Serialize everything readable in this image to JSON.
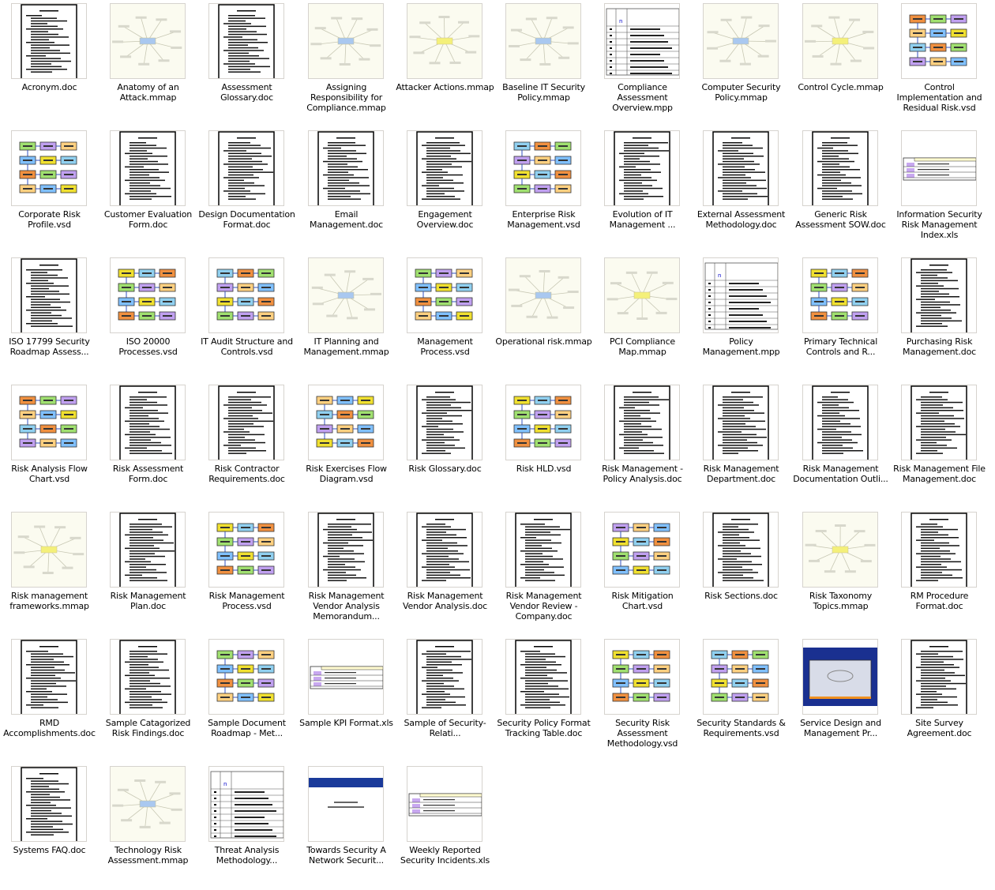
{
  "view": "thumbnails",
  "files": [
    {
      "name": "Acronym.doc",
      "type": "doc"
    },
    {
      "name": "Anatomy of an Attack.mmap",
      "type": "mmap"
    },
    {
      "name": "Assessment Glossary.doc",
      "type": "doc"
    },
    {
      "name": "Assigning Responsibility for Compliance.mmap",
      "type": "mmap"
    },
    {
      "name": "Attacker Actions.mmap",
      "type": "mmap"
    },
    {
      "name": "Baseline IT Security Policy.mmap",
      "type": "mmap"
    },
    {
      "name": "Compliance Assessment Overview.mpp",
      "type": "mpp"
    },
    {
      "name": "Computer Security Policy.mmap",
      "type": "mmap"
    },
    {
      "name": "Control Cycle.mmap",
      "type": "mmap"
    },
    {
      "name": "Control Implementation and Residual Risk.vsd",
      "type": "vsd"
    },
    {
      "name": "Corporate Risk Profile.vsd",
      "type": "vsd"
    },
    {
      "name": "Customer Evaluation Form.doc",
      "type": "doc"
    },
    {
      "name": "Design Documentation Format.doc",
      "type": "doc"
    },
    {
      "name": "Email Management.doc",
      "type": "doc"
    },
    {
      "name": "Engagement Overview.doc",
      "type": "doc"
    },
    {
      "name": "Enterprise Risk Management.vsd",
      "type": "vsd"
    },
    {
      "name": "Evolution of IT Management ...",
      "type": "doc"
    },
    {
      "name": "External Assessment Methodology.doc",
      "type": "doc"
    },
    {
      "name": "Generic Risk Assessment SOW.doc",
      "type": "doc"
    },
    {
      "name": "Information Security Risk Management Index.xls",
      "type": "xls"
    },
    {
      "name": "ISO 17799 Security Roadmap Assess...",
      "type": "doc"
    },
    {
      "name": "ISO 20000 Processes.vsd",
      "type": "vsd"
    },
    {
      "name": "IT Audit Structure and Controls.vsd",
      "type": "vsd"
    },
    {
      "name": "IT Planning and Management.mmap",
      "type": "mmap"
    },
    {
      "name": "Management Process.vsd",
      "type": "vsd"
    },
    {
      "name": "Operational risk.mmap",
      "type": "mmap"
    },
    {
      "name": "PCI Compliance Map.mmap",
      "type": "mmap"
    },
    {
      "name": "Policy Management.mpp",
      "type": "mpp"
    },
    {
      "name": "Primary Technical Controls and R...",
      "type": "vsd"
    },
    {
      "name": "Purchasing Risk Management.doc",
      "type": "doc"
    },
    {
      "name": "Risk Analysis Flow Chart.vsd",
      "type": "vsd"
    },
    {
      "name": "Risk Assessment Form.doc",
      "type": "doc"
    },
    {
      "name": "Risk Contractor Requirements.doc",
      "type": "doc"
    },
    {
      "name": "Risk Exercises Flow Diagram.vsd",
      "type": "vsd"
    },
    {
      "name": "Risk Glossary.doc",
      "type": "doc"
    },
    {
      "name": "Risk HLD.vsd",
      "type": "vsd"
    },
    {
      "name": "Risk Management - Policy Analysis.doc",
      "type": "doc"
    },
    {
      "name": "Risk Management Department.doc",
      "type": "doc"
    },
    {
      "name": "Risk Management Documentation Outli...",
      "type": "doc"
    },
    {
      "name": "Risk Management File Management.doc",
      "type": "doc"
    },
    {
      "name": "Risk management frameworks.mmap",
      "type": "mmap"
    },
    {
      "name": "Risk Management Plan.doc",
      "type": "doc"
    },
    {
      "name": "Risk Management Process.vsd",
      "type": "vsd"
    },
    {
      "name": "Risk Management Vendor Analysis Memorandum...",
      "type": "doc"
    },
    {
      "name": "Risk Management Vendor Analysis.doc",
      "type": "doc"
    },
    {
      "name": "Risk Management Vendor Review - Company.doc",
      "type": "doc"
    },
    {
      "name": "Risk Mitigation Chart.vsd",
      "type": "vsd"
    },
    {
      "name": "Risk Sections.doc",
      "type": "doc"
    },
    {
      "name": "Risk Taxonomy Topics.mmap",
      "type": "mmap"
    },
    {
      "name": "RM Procedure Format.doc",
      "type": "doc"
    },
    {
      "name": "RMD Accomplishments.doc",
      "type": "doc"
    },
    {
      "name": "Sample Catagorized Risk Findings.doc",
      "type": "doc"
    },
    {
      "name": "Sample Document Roadmap - Met...",
      "type": "vsd"
    },
    {
      "name": "Sample KPI Format.xls",
      "type": "xls"
    },
    {
      "name": "Sample of Security-Relati...",
      "type": "doc"
    },
    {
      "name": "Security Policy Format Tracking Table.doc",
      "type": "doc"
    },
    {
      "name": "Security Risk Assessment Methodology.vsd",
      "type": "vsd"
    },
    {
      "name": "Security Standards & Requirements.vsd",
      "type": "vsd"
    },
    {
      "name": "Service Design and Management Pr...",
      "type": "ppt"
    },
    {
      "name": "Site Survey Agreement.doc",
      "type": "doc"
    },
    {
      "name": "Systems FAQ.doc",
      "type": "doc"
    },
    {
      "name": "Technology Risk Assessment.mmap",
      "type": "mmap"
    },
    {
      "name": "Threat Analysis Methodology...",
      "type": "mpp"
    },
    {
      "name": "Towards Security A Network Securit...",
      "type": "ppt"
    },
    {
      "name": "Weekly Reported Security Incidents.xls",
      "type": "xls"
    }
  ],
  "colors": {
    "thumb_border": "#d6d3ce",
    "mindmap_bg": "#fbfbf0",
    "mindmap_center": "#f4f07a",
    "accent_blue": "#1a3a9a"
  }
}
